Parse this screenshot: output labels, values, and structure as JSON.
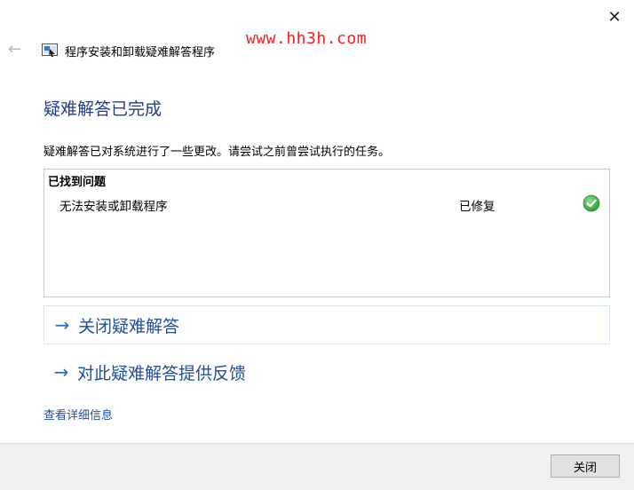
{
  "window": {
    "close_glyph": "✕",
    "back_glyph": "←",
    "title": "程序安装和卸载疑难解答程序",
    "watermark": "www.hh3h.com"
  },
  "main": {
    "heading": "疑难解答已完成",
    "description": "疑难解答已对系统进行了一些更改。请尝试之前曾尝试执行的任务。",
    "results": {
      "header": "已找到问题",
      "issues": [
        {
          "name": "无法安装或卸载程序",
          "status": "已修复",
          "status_icon": "green-check-icon"
        }
      ]
    },
    "links": [
      {
        "arrow": "→",
        "label": "关闭疑难解答"
      },
      {
        "arrow": "→",
        "label": "对此疑难解答提供反馈"
      }
    ],
    "details_link": "查看详细信息"
  },
  "footer": {
    "close_button": "关闭"
  },
  "colors": {
    "heading": "#1f3c8a",
    "link": "#1f4e9a",
    "arrow": "#1f6fc5",
    "watermark": "#ff1a1a",
    "success": "#3cb043",
    "footer_bg": "#f0f0f0"
  }
}
